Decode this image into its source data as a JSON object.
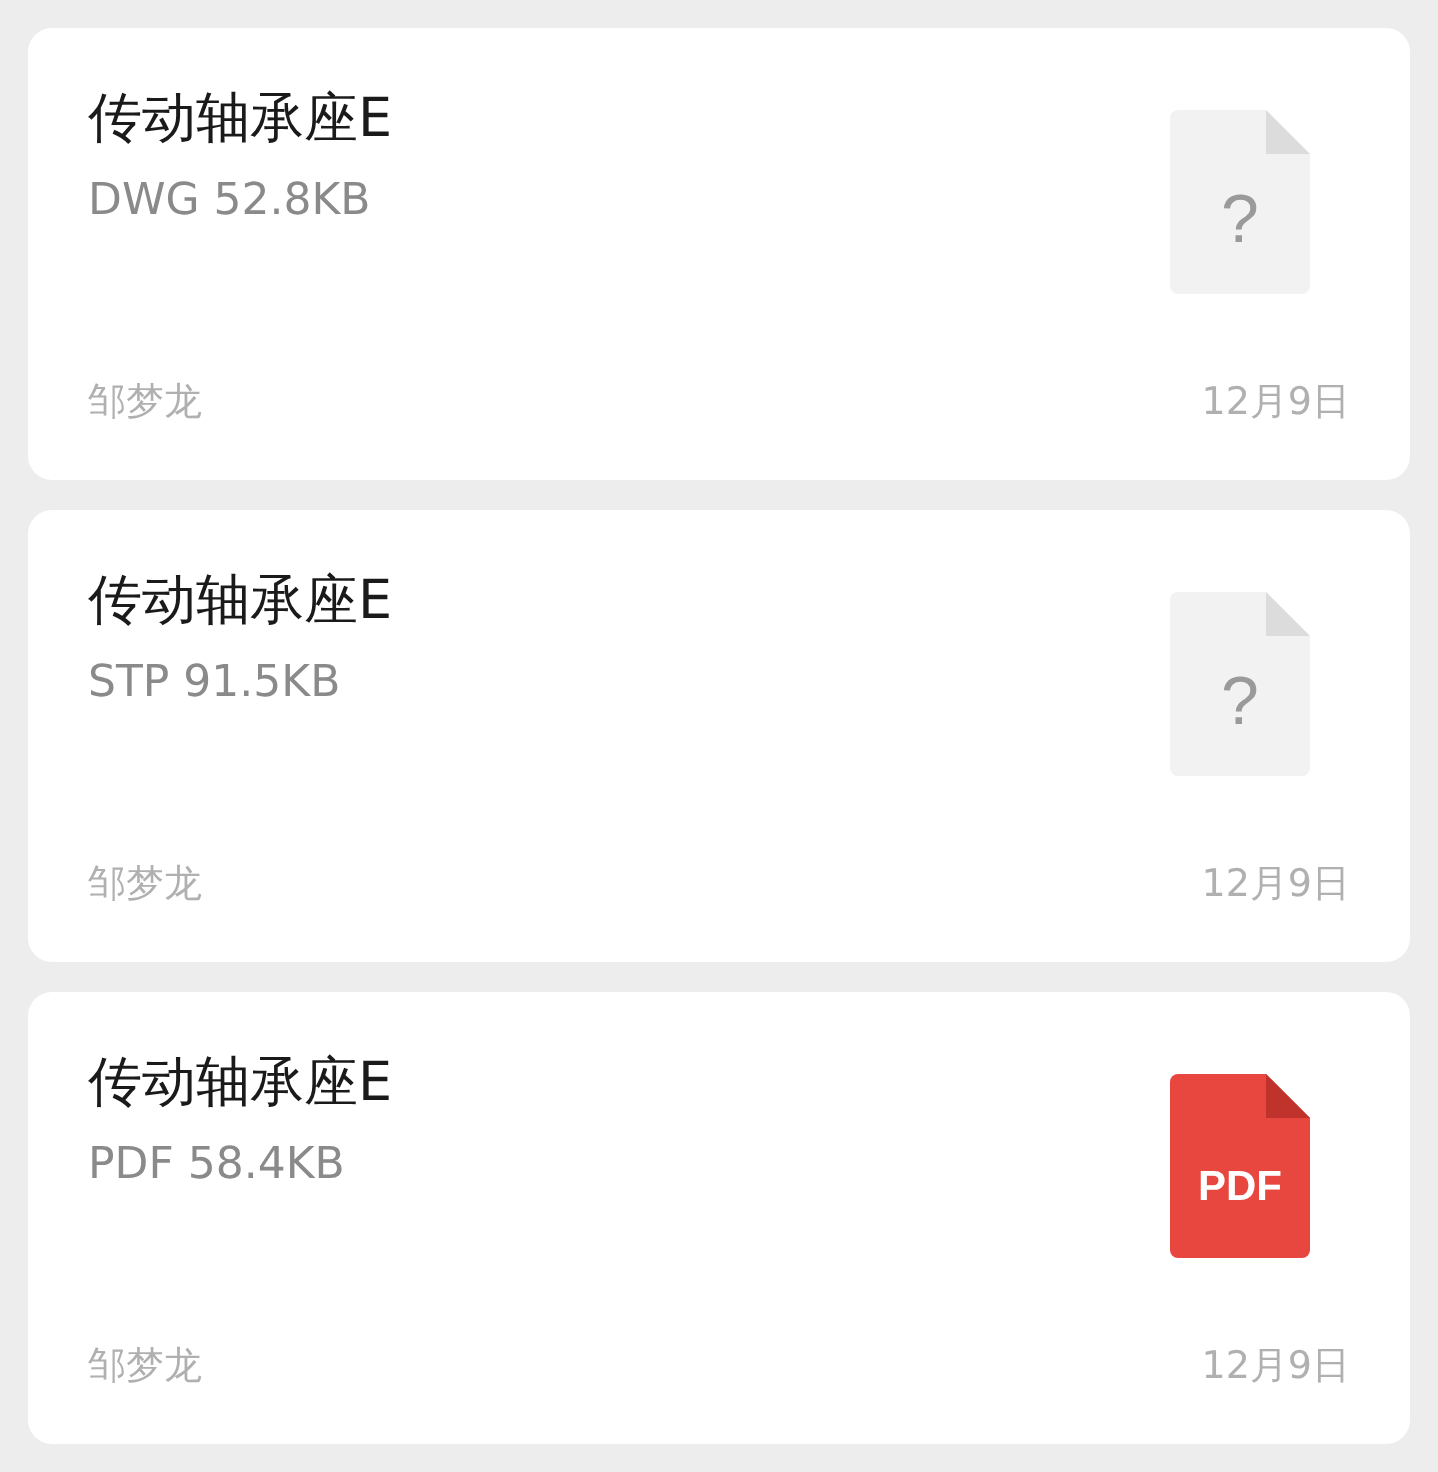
{
  "files": [
    {
      "name": "传动轴承座E",
      "meta": "DWG 52.8KB",
      "kind": "unknown",
      "icon_text": "?",
      "sender": "邹梦龙",
      "date": "12月9日"
    },
    {
      "name": "传动轴承座E",
      "meta": "STP 91.5KB",
      "kind": "unknown",
      "icon_text": "?",
      "sender": "邹梦龙",
      "date": "12月9日"
    },
    {
      "name": "传动轴承座E",
      "meta": "PDF 58.4KB",
      "kind": "pdf",
      "icon_text": "PDF",
      "sender": "邹梦龙",
      "date": "12月9日"
    }
  ]
}
